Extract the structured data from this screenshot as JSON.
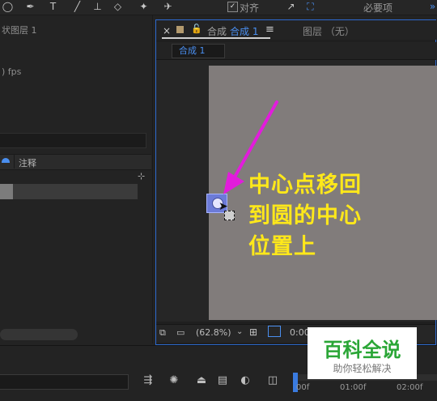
{
  "toolbar": {
    "align_label": "对齐",
    "workspace_label": "必要项"
  },
  "left_panel": {
    "layer_label": "状图层 1",
    "fps_label": ") fps",
    "comment_label": "注释"
  },
  "composition": {
    "tab_prefix": "合成",
    "tab_name": "合成 1",
    "layer_label": "图层 （无）",
    "sub_tab": "合成 1",
    "zoom": "(62.8%)",
    "timecode": "0:00"
  },
  "annotation": {
    "text": "中心点移回\n到圆的中心\n位置上"
  },
  "timeline": {
    "ruler_labels": [
      "00f",
      "01:00f",
      "02:00f"
    ]
  },
  "watermark": {
    "title": "百科全说",
    "subtitle": "助你轻松解决"
  },
  "colors": {
    "accent_blue": "#2d6ad0",
    "annotation_yellow": "#ffe81a",
    "arrow_magenta": "#e21cdc",
    "watermark_green": "#2aa636",
    "canvas_gray": "#817c7b"
  }
}
